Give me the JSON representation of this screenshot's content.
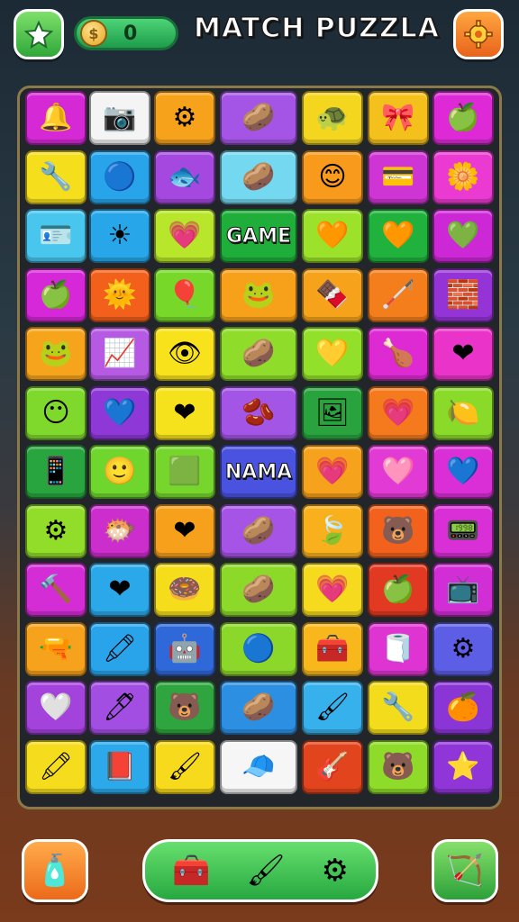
{
  "header": {
    "title": "MATCH PUZZLA",
    "coins": "0",
    "coin_symbol": "$",
    "star_icon": "star-icon",
    "settings_icon": "gear-icon"
  },
  "board": {
    "tiles": [
      {
        "bg": "#d629d6",
        "icon": "🔔"
      },
      {
        "bg": "#f4f4f4",
        "icon": "📷"
      },
      {
        "bg": "#f6a21a",
        "icon": "⚙"
      },
      {
        "bg": "#a555e6",
        "icon": "🥔"
      },
      {
        "bg": "#f5d61f",
        "icon": "🐢"
      },
      {
        "bg": "#f4c01b",
        "icon": "🎀"
      },
      {
        "bg": "#dd2ad6",
        "icon": "🍏"
      },
      {
        "bg": "#f5de1c",
        "icon": "🔧"
      },
      {
        "bg": "#27a4ea",
        "icon": "🔵"
      },
      {
        "bg": "#a548e0",
        "icon": "🐟"
      },
      {
        "bg": "#74d8f0",
        "icon": "🥔"
      },
      {
        "bg": "#f89a1c",
        "icon": "😊"
      },
      {
        "bg": "#cf34d4",
        "icon": "💳"
      },
      {
        "bg": "#ea3ad2",
        "icon": "🌼"
      },
      {
        "bg": "#49c6ee",
        "icon": "🪪"
      },
      {
        "bg": "#27a6ea",
        "icon": "☀"
      },
      {
        "bg": "#b8e62a",
        "icon": "💗"
      },
      {
        "bg": "#1fae3a",
        "text": "GAME",
        "wide": true
      },
      {
        "bg": "#9ce22a",
        "icon": "🧡"
      },
      {
        "bg": "#21b23e",
        "icon": "🧡"
      },
      {
        "bg": "#cd28d6",
        "icon": "💚"
      },
      {
        "bg": "#d628d8",
        "icon": "🍏"
      },
      {
        "bg": "#f2601c",
        "icon": "🌞"
      },
      {
        "bg": "#77d82a",
        "icon": "🎈"
      },
      {
        "bg": "#f7a01a",
        "icon": "🐸",
        "wide": true
      },
      {
        "bg": "#f6a31b",
        "icon": "🍫"
      },
      {
        "bg": "#f57e1c",
        "icon": "🦯"
      },
      {
        "bg": "#9434d6",
        "icon": "🧱"
      },
      {
        "bg": "#f7a41d",
        "icon": "🐸"
      },
      {
        "bg": "#b65ae4",
        "icon": "📈"
      },
      {
        "bg": "#f8e21c",
        "icon": "👁"
      },
      {
        "bg": "#8fdd2a",
        "icon": "🥔",
        "wide": true
      },
      {
        "bg": "#93e02a",
        "icon": "💛"
      },
      {
        "bg": "#dd2ad2",
        "icon": "🍗"
      },
      {
        "bg": "#ea34c9",
        "icon": "❤"
      },
      {
        "bg": "#7fd82c",
        "icon": "😶"
      },
      {
        "bg": "#8e38d8",
        "icon": "💙"
      },
      {
        "bg": "#f6e21c",
        "icon": "❤"
      },
      {
        "bg": "#a355e6",
        "icon": "🫘",
        "wide": true
      },
      {
        "bg": "#29a33e",
        "icon": "🖼"
      },
      {
        "bg": "#f57a1d",
        "icon": "💗"
      },
      {
        "bg": "#8ada2a",
        "icon": "🍋"
      },
      {
        "bg": "#28a53e",
        "icon": "📱"
      },
      {
        "bg": "#6fd62e",
        "icon": "🙂"
      },
      {
        "bg": "#76d62c",
        "icon": "🟩"
      },
      {
        "bg": "#4a52e0",
        "text": "NAMA",
        "wide": true
      },
      {
        "bg": "#f7a21c",
        "icon": "💗"
      },
      {
        "bg": "#e23bd5",
        "icon": "🩷"
      },
      {
        "bg": "#da2ed6",
        "icon": "💙"
      },
      {
        "bg": "#92dc2a",
        "icon": "⚙"
      },
      {
        "bg": "#cb2ecc",
        "icon": "🐡"
      },
      {
        "bg": "#f7a01c",
        "icon": "❤"
      },
      {
        "bg": "#a654e6",
        "icon": "🥔",
        "wide": true
      },
      {
        "bg": "#f8b01c",
        "icon": "🍃"
      },
      {
        "bg": "#f3621c",
        "icon": "🐻"
      },
      {
        "bg": "#d82fd6",
        "icon": "📟"
      },
      {
        "bg": "#d52dd6",
        "icon": "🔨"
      },
      {
        "bg": "#2ba8ea",
        "icon": "❤"
      },
      {
        "bg": "#f5dd1c",
        "icon": "🍩"
      },
      {
        "bg": "#8cd92a",
        "icon": "🥔",
        "wide": true
      },
      {
        "bg": "#f5da1d",
        "icon": "💗"
      },
      {
        "bg": "#e23a22",
        "icon": "🍏"
      },
      {
        "bg": "#d22ed6",
        "icon": "📺"
      },
      {
        "bg": "#f7a21c",
        "icon": "🔫"
      },
      {
        "bg": "#29a3ea",
        "icon": "🖍"
      },
      {
        "bg": "#2f68d9",
        "icon": "🤖"
      },
      {
        "bg": "#8cd82a",
        "icon": "🔵",
        "wide": true
      },
      {
        "bg": "#f8b81c",
        "icon": "🧰"
      },
      {
        "bg": "#de34d2",
        "icon": "🧻"
      },
      {
        "bg": "#5c5ee6",
        "icon": "⚙"
      },
      {
        "bg": "#a442dc",
        "icon": "🤍"
      },
      {
        "bg": "#a24ee2",
        "icon": "🖊"
      },
      {
        "bg": "#2ea53e",
        "icon": "🐻"
      },
      {
        "bg": "#2d8fe2",
        "icon": "🥔",
        "wide": true
      },
      {
        "bg": "#37b1ec",
        "icon": "🖌"
      },
      {
        "bg": "#f3dc1c",
        "icon": "🔧"
      },
      {
        "bg": "#8a36d6",
        "icon": "🍊"
      },
      {
        "bg": "#f5dc1c",
        "icon": "🖍"
      },
      {
        "bg": "#2ba9ea",
        "icon": "📕"
      },
      {
        "bg": "#f7da1b",
        "icon": "🖌"
      },
      {
        "bg": "#f6f6f6",
        "icon": "🧢",
        "wide": true
      },
      {
        "bg": "#e2451e",
        "icon": "🎸"
      },
      {
        "bg": "#8edb2a",
        "icon": "🐻"
      },
      {
        "bg": "#9036d8",
        "icon": "⭐"
      }
    ]
  },
  "footer": {
    "left_icon": "🧴",
    "right_icon": "🏹",
    "tools": [
      "🧰",
      "🖌",
      "⚙"
    ]
  }
}
